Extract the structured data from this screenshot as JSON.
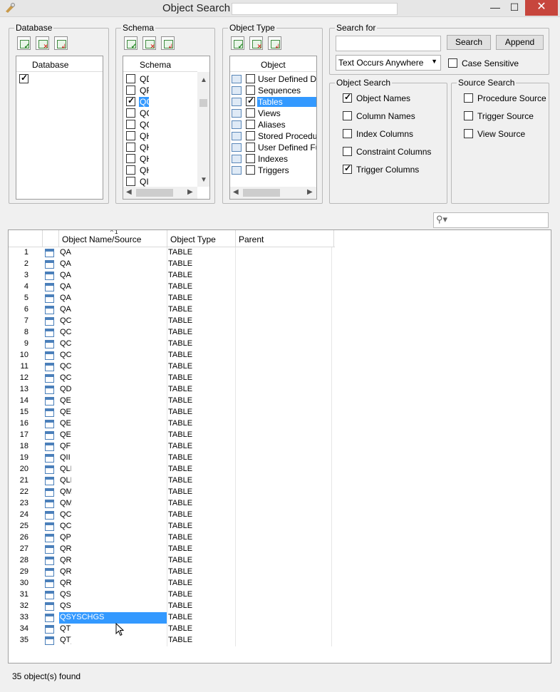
{
  "window": {
    "title": "Object Search",
    "title_input": "",
    "min_label": "—",
    "max_label": "☐",
    "close_label": "✕"
  },
  "database_group": {
    "label": "Database",
    "column": "Database",
    "rows": [
      {
        "checked": true,
        "text": ""
      }
    ]
  },
  "schema_group": {
    "label": "Schema",
    "column": "Schema",
    "rows": [
      {
        "checked": false,
        "text": "QD"
      },
      {
        "checked": false,
        "text": "QF"
      },
      {
        "checked": true,
        "text": "QG",
        "selected": true
      },
      {
        "checked": false,
        "text": "QG"
      },
      {
        "checked": false,
        "text": "QG"
      },
      {
        "checked": false,
        "text": "QH"
      },
      {
        "checked": false,
        "text": "QH"
      },
      {
        "checked": false,
        "text": "QH"
      },
      {
        "checked": false,
        "text": "QH"
      },
      {
        "checked": false,
        "text": "QI("
      }
    ]
  },
  "objecttype_group": {
    "label": "Object Type",
    "column": "Object",
    "rows": [
      {
        "checked": false,
        "text": "User Defined Dat",
        "icon": "user-defined-type-icon"
      },
      {
        "checked": false,
        "text": "Sequences",
        "icon": "sequence-icon"
      },
      {
        "checked": true,
        "text": "Tables",
        "icon": "table-icon",
        "selected": true
      },
      {
        "checked": false,
        "text": "Views",
        "icon": "view-icon"
      },
      {
        "checked": false,
        "text": "Aliases",
        "icon": "alias-icon"
      },
      {
        "checked": false,
        "text": "Stored Procedure",
        "icon": "stored-procedure-icon"
      },
      {
        "checked": false,
        "text": "User Defined Fun",
        "icon": "function-icon"
      },
      {
        "checked": false,
        "text": "Indexes",
        "icon": "index-icon"
      },
      {
        "checked": false,
        "text": "Triggers",
        "icon": "trigger-icon"
      }
    ]
  },
  "search": {
    "label": "Search for",
    "value": "",
    "search_button": "Search",
    "append_button": "Append",
    "mode": "Text Occurs Anywhere",
    "case_sensitive": {
      "label": "Case Sensitive",
      "checked": false
    }
  },
  "object_search": {
    "label": "Object Search",
    "options": [
      {
        "label": "Object Names",
        "checked": true
      },
      {
        "label": "Column Names",
        "checked": false
      },
      {
        "label": "Index Columns",
        "checked": false
      },
      {
        "label": "Constraint Columns",
        "checked": false
      },
      {
        "label": "Trigger Columns",
        "checked": true
      }
    ]
  },
  "source_search": {
    "label": "Source Search",
    "options": [
      {
        "label": "Procedure Source",
        "checked": false
      },
      {
        "label": "Trigger Source",
        "checked": false
      },
      {
        "label": "View Source",
        "checked": false
      }
    ]
  },
  "grid": {
    "columns": [
      "Object Name/Source",
      "Object Type",
      "Parent"
    ],
    "sort_indicator": "^ 1",
    "filter_value": "",
    "rows": [
      {
        "n": "1",
        "name": "QA",
        "type": "TABLE"
      },
      {
        "n": "2",
        "name": "QA",
        "type": "TABLE"
      },
      {
        "n": "3",
        "name": "QA",
        "type": "TABLE"
      },
      {
        "n": "4",
        "name": "QA",
        "type": "TABLE"
      },
      {
        "n": "5",
        "name": "QA",
        "type": "TABLE"
      },
      {
        "n": "6",
        "name": "QA",
        "type": "TABLE"
      },
      {
        "n": "7",
        "name": "QC",
        "type": "TABLE"
      },
      {
        "n": "8",
        "name": "QC",
        "type": "TABLE"
      },
      {
        "n": "9",
        "name": "QC",
        "type": "TABLE"
      },
      {
        "n": "10",
        "name": "QC",
        "type": "TABLE"
      },
      {
        "n": "11",
        "name": "QC",
        "type": "TABLE"
      },
      {
        "n": "12",
        "name": "QC",
        "type": "TABLE"
      },
      {
        "n": "13",
        "name": "QD",
        "type": "TABLE"
      },
      {
        "n": "14",
        "name": "QE",
        "type": "TABLE"
      },
      {
        "n": "15",
        "name": "QE",
        "type": "TABLE"
      },
      {
        "n": "16",
        "name": "QE",
        "type": "TABLE"
      },
      {
        "n": "17",
        "name": "QE",
        "type": "TABLE"
      },
      {
        "n": "18",
        "name": "QF",
        "type": "TABLE"
      },
      {
        "n": "19",
        "name": "QII",
        "type": "TABLE"
      },
      {
        "n": "20",
        "name": "QLI",
        "type": "TABLE"
      },
      {
        "n": "21",
        "name": "QLI",
        "type": "TABLE"
      },
      {
        "n": "22",
        "name": "QM",
        "type": "TABLE"
      },
      {
        "n": "23",
        "name": "QM",
        "type": "TABLE"
      },
      {
        "n": "24",
        "name": "QC",
        "type": "TABLE"
      },
      {
        "n": "25",
        "name": "QC",
        "type": "TABLE"
      },
      {
        "n": "26",
        "name": "QP",
        "type": "TABLE"
      },
      {
        "n": "27",
        "name": "QR",
        "type": "TABLE"
      },
      {
        "n": "28",
        "name": "QR",
        "type": "TABLE"
      },
      {
        "n": "29",
        "name": "QR",
        "type": "TABLE"
      },
      {
        "n": "30",
        "name": "QR",
        "type": "TABLE"
      },
      {
        "n": "31",
        "name": "QS",
        "type": "TABLE"
      },
      {
        "n": "32",
        "name": "QS",
        "type": "TABLE"
      },
      {
        "n": "33",
        "name": "QSYSCHGS",
        "type": "TABLE",
        "selected": true
      },
      {
        "n": "34",
        "name": "QTE",
        "type": "TABLE"
      },
      {
        "n": "35",
        "name": "QT)",
        "type": "TABLE"
      }
    ]
  },
  "status": "35 object(s) found",
  "colors": {
    "selection": "#3399ff",
    "close": "#c7463d",
    "background": "#f0f0f0"
  }
}
